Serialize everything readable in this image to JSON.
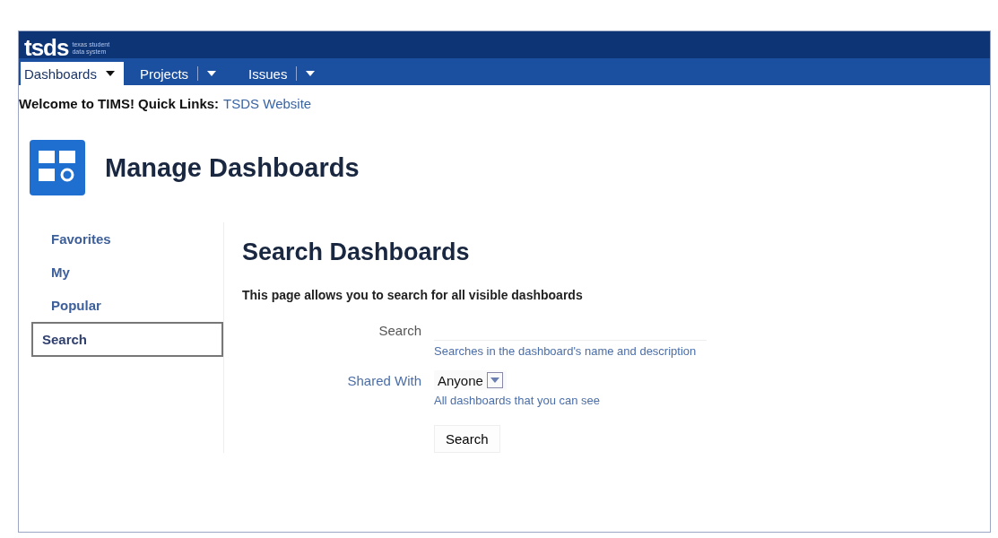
{
  "logo": {
    "text": "tsds",
    "tagline": [
      "texas student",
      "data system"
    ]
  },
  "nav": [
    {
      "label": "Dashboards",
      "selected": true
    },
    {
      "label": "Projects",
      "selected": false
    },
    {
      "label": "Issues",
      "selected": false
    }
  ],
  "welcome": {
    "text": "Welcome to TIMS! Quick Links:",
    "link": "TSDS Website"
  },
  "page_title": "Manage Dashboards",
  "sidebar": [
    {
      "label": "Favorites",
      "selected": false
    },
    {
      "label": "My",
      "selected": false
    },
    {
      "label": "Popular",
      "selected": false
    },
    {
      "label": "Search",
      "selected": true
    }
  ],
  "section_title": "Search Dashboards",
  "intro": "This page allows you to search for all visible dashboards",
  "form": [
    {
      "kind": "text",
      "label": "Search",
      "hint": "Searches in the dashboard's name and description"
    },
    {
      "kind": "select",
      "label": "Shared With",
      "value": "Anyone",
      "hint": "All dashboards that you can see"
    }
  ],
  "submit": "Search"
}
